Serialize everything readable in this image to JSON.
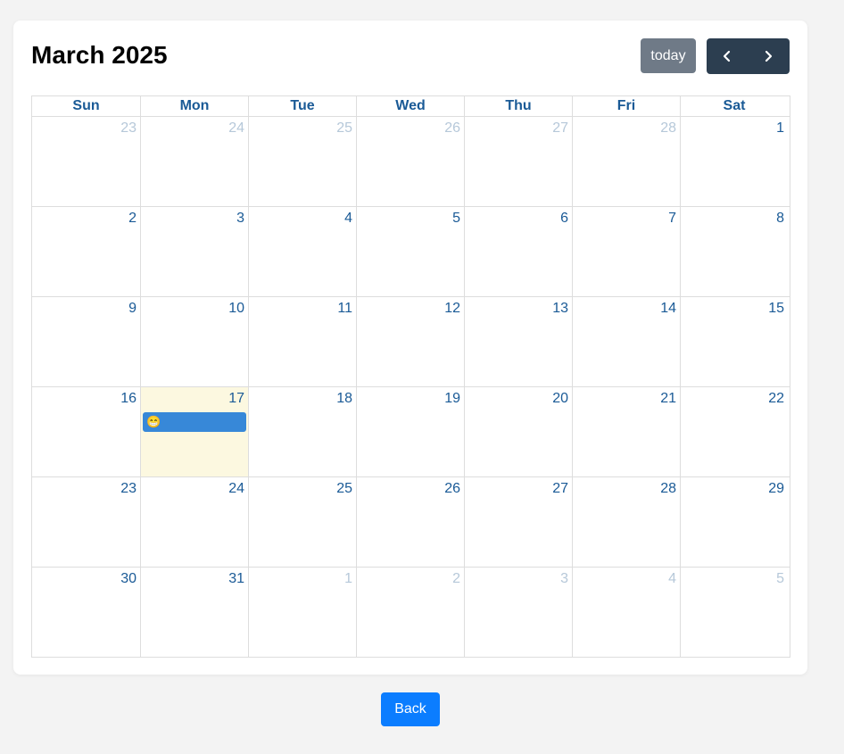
{
  "calendar": {
    "title": "March 2025",
    "today_label": "today",
    "prev_icon": "chevron-left-icon",
    "next_icon": "chevron-right-icon",
    "weekdays": [
      "Sun",
      "Mon",
      "Tue",
      "Wed",
      "Thu",
      "Fri",
      "Sat"
    ],
    "weeks": [
      [
        {
          "day": "23",
          "other": true
        },
        {
          "day": "24",
          "other": true
        },
        {
          "day": "25",
          "other": true
        },
        {
          "day": "26",
          "other": true
        },
        {
          "day": "27",
          "other": true
        },
        {
          "day": "28",
          "other": true
        },
        {
          "day": "1",
          "other": false
        }
      ],
      [
        {
          "day": "2",
          "other": false
        },
        {
          "day": "3",
          "other": false
        },
        {
          "day": "4",
          "other": false
        },
        {
          "day": "5",
          "other": false
        },
        {
          "day": "6",
          "other": false
        },
        {
          "day": "7",
          "other": false
        },
        {
          "day": "8",
          "other": false
        }
      ],
      [
        {
          "day": "9",
          "other": false
        },
        {
          "day": "10",
          "other": false
        },
        {
          "day": "11",
          "other": false
        },
        {
          "day": "12",
          "other": false
        },
        {
          "day": "13",
          "other": false
        },
        {
          "day": "14",
          "other": false
        },
        {
          "day": "15",
          "other": false
        }
      ],
      [
        {
          "day": "16",
          "other": false
        },
        {
          "day": "17",
          "other": false,
          "today": true,
          "event": {
            "emoji": "😁",
            "color": "#3788d8"
          }
        },
        {
          "day": "18",
          "other": false
        },
        {
          "day": "19",
          "other": false
        },
        {
          "day": "20",
          "other": false
        },
        {
          "day": "21",
          "other": false
        },
        {
          "day": "22",
          "other": false
        }
      ],
      [
        {
          "day": "23",
          "other": false
        },
        {
          "day": "24",
          "other": false
        },
        {
          "day": "25",
          "other": false
        },
        {
          "day": "26",
          "other": false
        },
        {
          "day": "27",
          "other": false
        },
        {
          "day": "28",
          "other": false
        },
        {
          "day": "29",
          "other": false
        }
      ],
      [
        {
          "day": "30",
          "other": false
        },
        {
          "day": "31",
          "other": false
        },
        {
          "day": "1",
          "other": true
        },
        {
          "day": "2",
          "other": true
        },
        {
          "day": "3",
          "other": true
        },
        {
          "day": "4",
          "other": true
        },
        {
          "day": "5",
          "other": true
        }
      ]
    ]
  },
  "footer": {
    "back_label": "Back"
  },
  "colors": {
    "today_bg": "#fcf8e0",
    "event": "#3788d8",
    "nav": "#2c3e50",
    "today_button": "#6f7a87",
    "back_button": "#0b7dff",
    "day_number": "#1a5a96",
    "other_month_day": "#b6c8d9"
  }
}
